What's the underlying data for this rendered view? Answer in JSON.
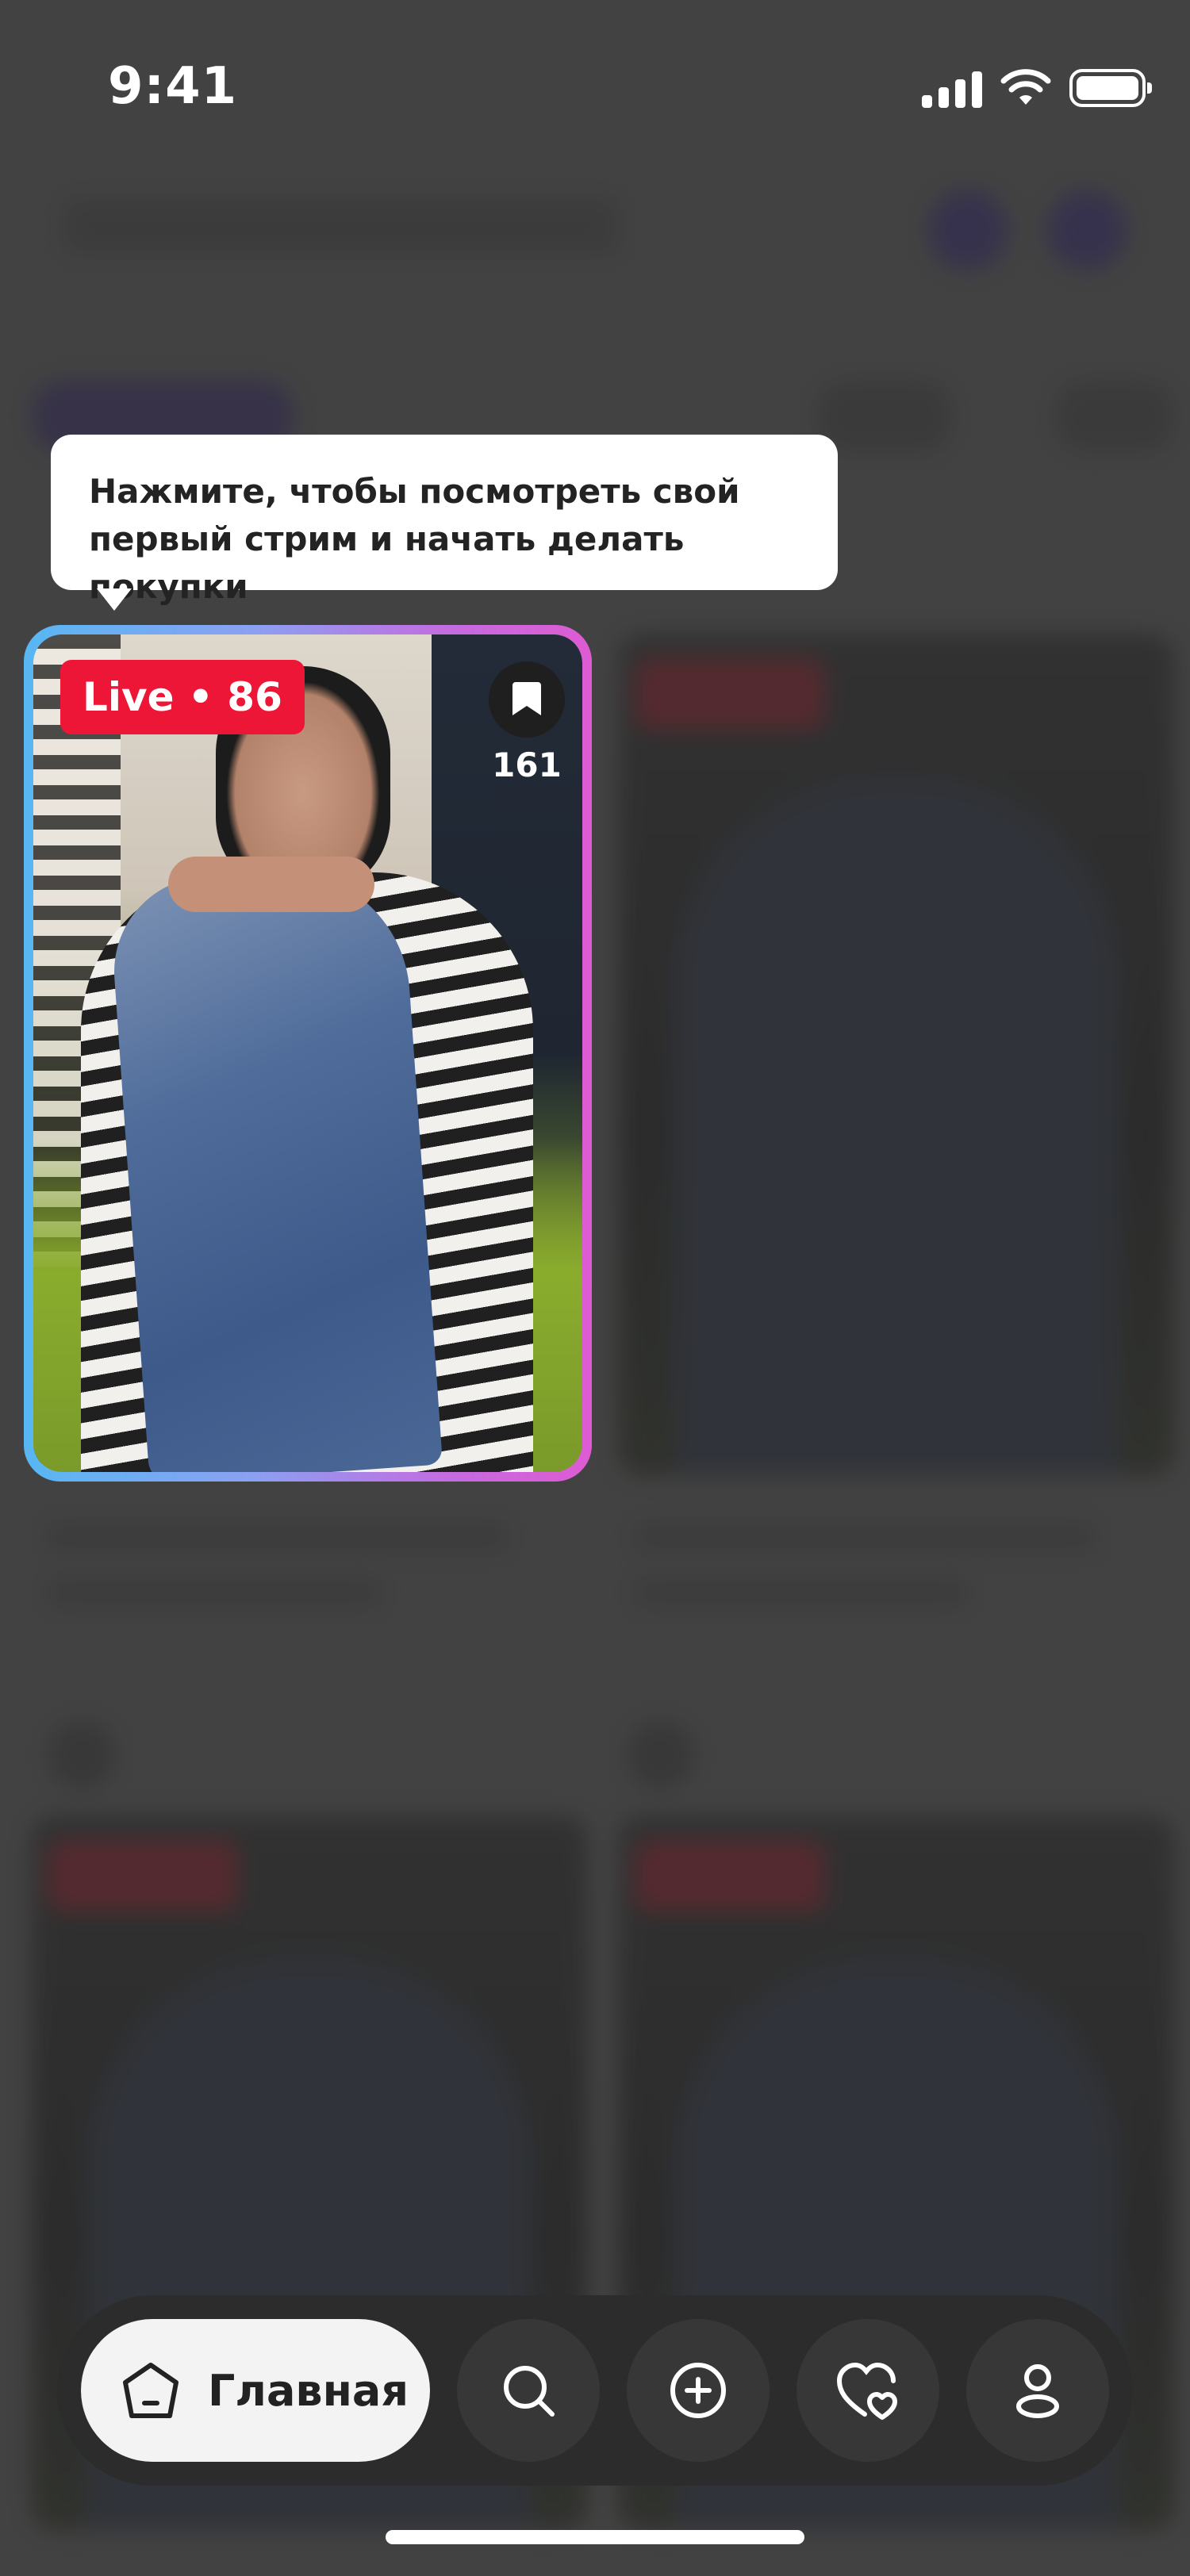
{
  "status_bar": {
    "time": "9:41",
    "icons": [
      "signal-icon",
      "wifi-icon",
      "battery-icon"
    ]
  },
  "tooltip": {
    "text": "Нажмите, чтобы посмотреть свой\nпервый стрим и начать делать\nпокупки"
  },
  "live_card": {
    "badge": "Live • 86",
    "bookmark_icon": "bookmark-icon",
    "bookmark_count": "161",
    "border_gradient": [
      "#58b7f3",
      "#de5bd3"
    ],
    "badge_color": "#ee1636"
  },
  "tab_bar": {
    "home": {
      "label": "Главная",
      "icon": "home-icon"
    },
    "items": [
      {
        "icon": "search-icon"
      },
      {
        "icon": "add-icon"
      },
      {
        "icon": "favorites-icon"
      },
      {
        "icon": "profile-icon"
      }
    ]
  }
}
